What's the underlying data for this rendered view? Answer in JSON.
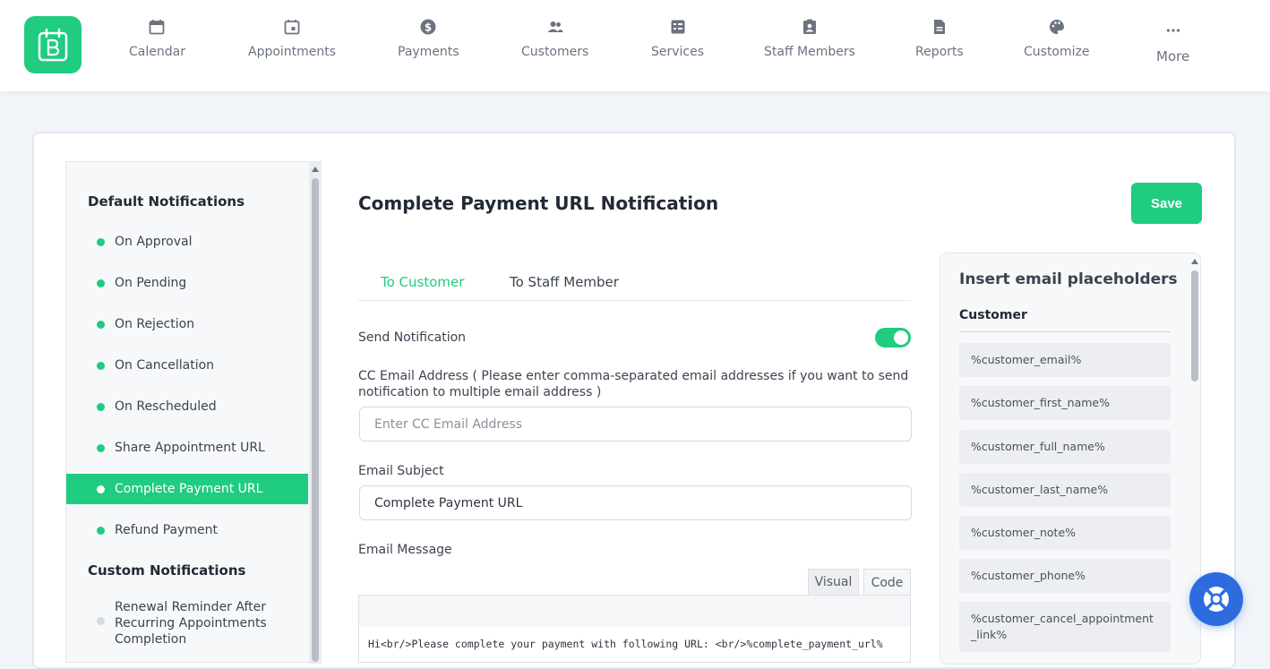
{
  "nav": {
    "items": [
      {
        "label": "Calendar",
        "icon": "calendar-icon"
      },
      {
        "label": "Appointments",
        "icon": "appointment-icon"
      },
      {
        "label": "Payments",
        "icon": "dollar-icon"
      },
      {
        "label": "Customers",
        "icon": "customers-icon"
      },
      {
        "label": "Services",
        "icon": "services-icon"
      },
      {
        "label": "Staff Members",
        "icon": "staff-badge-icon"
      },
      {
        "label": "Reports",
        "icon": "report-icon"
      },
      {
        "label": "Customize",
        "icon": "palette-icon"
      },
      {
        "label": "More",
        "icon": "more-dots-icon"
      }
    ]
  },
  "sidebar": {
    "default_heading": "Default Notifications",
    "default_items": [
      {
        "label": "On Approval"
      },
      {
        "label": "On Pending"
      },
      {
        "label": "On Rejection"
      },
      {
        "label": "On Cancellation"
      },
      {
        "label": "On Rescheduled"
      },
      {
        "label": "Share Appointment URL"
      },
      {
        "label": "Complete Payment URL",
        "active": true
      },
      {
        "label": "Refund Payment"
      }
    ],
    "custom_heading": "Custom Notifications",
    "custom_items": [
      {
        "label": "Renewal Reminder After Recurring Appointments Completion"
      }
    ]
  },
  "content": {
    "title": "Complete Payment URL Notification",
    "save_label": "Save",
    "tabs": [
      {
        "label": "To Customer",
        "active": true
      },
      {
        "label": "To Staff Member",
        "active": false
      }
    ],
    "send_notification_label": "Send Notification",
    "send_notification_enabled": true,
    "cc_label": "CC Email Address ( Please enter comma-separated email addresses if you want to send notification to multiple email address )",
    "cc_placeholder": "Enter CC Email Address",
    "cc_value": "",
    "subject_label": "Email Subject",
    "subject_value": "Complete Payment URL",
    "message_label": "Email Message",
    "editor_tabs": {
      "visual": "Visual",
      "code": "Code"
    },
    "message_body": "Hi<br/>Please complete your payment with following URL: <br/>%complete_payment_url%"
  },
  "placeholders": {
    "title": "Insert email placeholders",
    "group": "Customer",
    "items": [
      "%customer_email%",
      "%customer_first_name%",
      "%customer_full_name%",
      "%customer_last_name%",
      "%customer_note%",
      "%customer_phone%",
      "%customer_cancel_appointment_link%"
    ]
  },
  "colors": {
    "accent": "#1fcc80",
    "help_button": "#2d6cdf"
  }
}
